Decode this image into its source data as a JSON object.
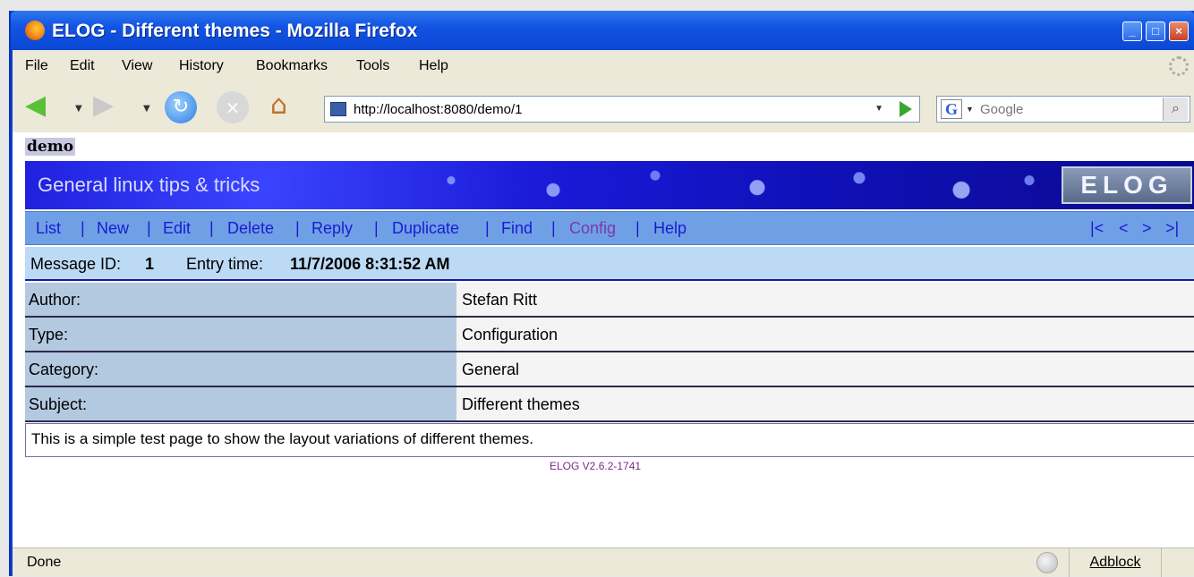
{
  "window": {
    "title": "ELOG - Different themes - Mozilla Firefox"
  },
  "menubar": {
    "items": [
      "File",
      "Edit",
      "View",
      "History",
      "Bookmarks",
      "Tools",
      "Help"
    ]
  },
  "navbar": {
    "url": "http://localhost:8080/demo/1",
    "search_placeholder": "Google",
    "search_engine_letter": "G"
  },
  "page": {
    "logbook_name": "demo",
    "banner_title": "General linux tips & tricks",
    "banner_logo": "ELOG",
    "commands": [
      "List",
      "New",
      "Edit",
      "Delete",
      "Reply",
      "Duplicate",
      "Find",
      "Config",
      "Help"
    ],
    "separator": "|",
    "nav_first": "|<",
    "nav_prev": "<",
    "nav_next": ">",
    "nav_last": ">|",
    "message_id_label": "Message ID:",
    "message_id": "1",
    "entry_time_label": "Entry time:",
    "entry_time": "11/7/2006 8:31:52 AM",
    "attributes": [
      {
        "label": "Author:",
        "value": "Stefan Ritt"
      },
      {
        "label": "Type:",
        "value": "Configuration"
      },
      {
        "label": "Category:",
        "value": "General"
      },
      {
        "label": "Subject:",
        "value": "Different themes"
      }
    ],
    "body": "This is a simple test page to show the layout variations of different themes.",
    "footer": "ELOG V2.6.2-1741"
  },
  "statusbar": {
    "status": "Done",
    "adblock": "Adblock"
  },
  "colors": {
    "banner": "#1a1ad8",
    "link": "#1b1bd0",
    "attr_label_bg": "#b3c9e0",
    "info_bg": "#bcdaf4"
  }
}
